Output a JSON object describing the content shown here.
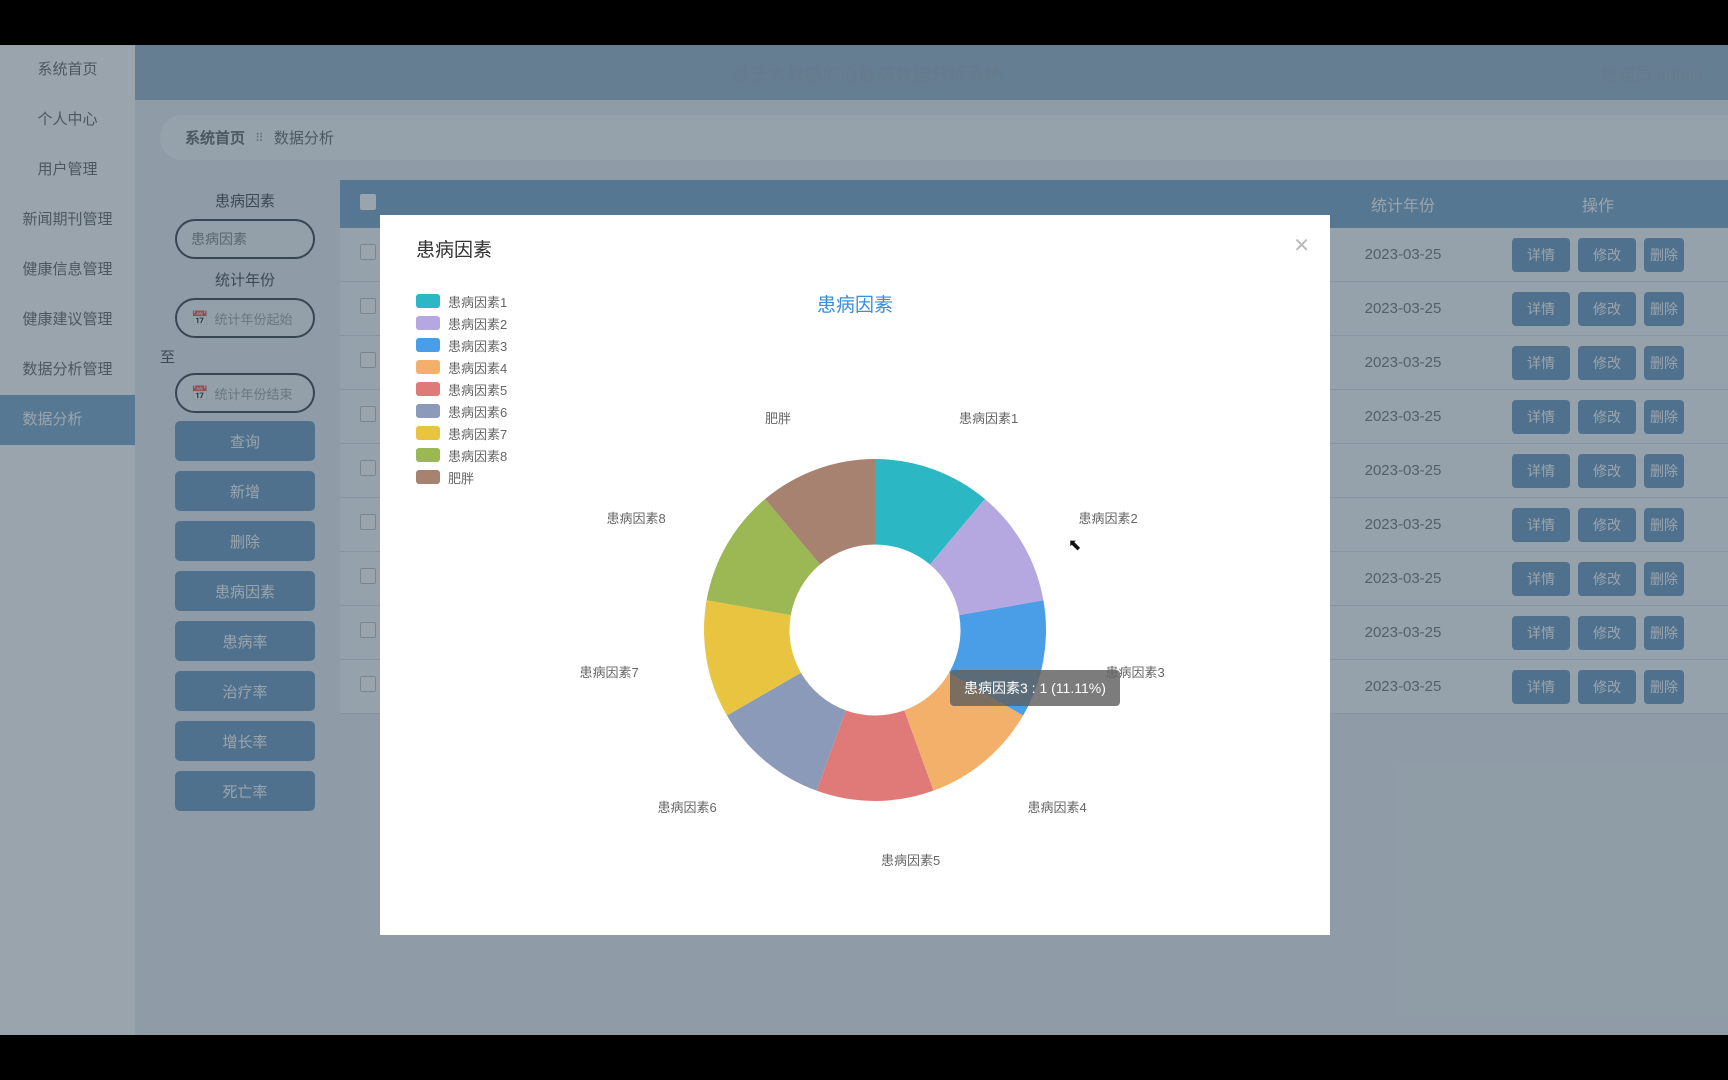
{
  "header": {
    "title": "基于大数据的心脏病数据分析系统",
    "user_role": "管理员",
    "user_name": "admin"
  },
  "sidebar": {
    "items": [
      {
        "label": "系统首页"
      },
      {
        "label": "个人中心"
      },
      {
        "label": "用户管理"
      },
      {
        "label": "新闻期刊管理"
      },
      {
        "label": "健康信息管理"
      },
      {
        "label": "健康建议管理"
      },
      {
        "label": "数据分析管理"
      },
      {
        "label": "数据分析",
        "active": true
      }
    ]
  },
  "breadcrumb": {
    "home": "系统首页",
    "sep": "⠿",
    "current": "数据分析"
  },
  "filters": {
    "factor_label": "患病因素",
    "factor_placeholder": "患病因素",
    "year_label": "统计年份",
    "year_start_placeholder": "统计年份起始",
    "between": "至",
    "year_end_placeholder": "统计年份结束",
    "buttons": [
      "查询",
      "新增",
      "删除",
      "患病因素",
      "患病率",
      "治疗率",
      "增长率",
      "死亡率"
    ]
  },
  "table": {
    "head_year": "统计年份",
    "head_ops": "操作",
    "row_year": "2023-03-25",
    "ops": {
      "detail": "详情",
      "edit": "修改",
      "del": "删除"
    },
    "rows": 9
  },
  "modal": {
    "title": "患病因素",
    "chart_title": "患病因素",
    "tooltip": "患病因素3 : 1 (11.11%)"
  },
  "chart_data": {
    "type": "pie",
    "title": "患病因素",
    "series": [
      {
        "name": "患病因素1",
        "value": 1,
        "color": "#2bb8c4"
      },
      {
        "name": "患病因素2",
        "value": 1,
        "color": "#b5a8e0"
      },
      {
        "name": "患病因素3",
        "value": 1,
        "color": "#4a9ee8"
      },
      {
        "name": "患病因素4",
        "value": 1,
        "color": "#f2b06a"
      },
      {
        "name": "患病因素5",
        "value": 1,
        "color": "#e07a78"
      },
      {
        "name": "患病因素6",
        "value": 1,
        "color": "#8a9ab8"
      },
      {
        "name": "患病因素7",
        "value": 1,
        "color": "#e8c441"
      },
      {
        "name": "患病因素8",
        "value": 1,
        "color": "#9cb854"
      },
      {
        "name": "肥胖",
        "value": 1,
        "color": "#a88270"
      }
    ]
  }
}
